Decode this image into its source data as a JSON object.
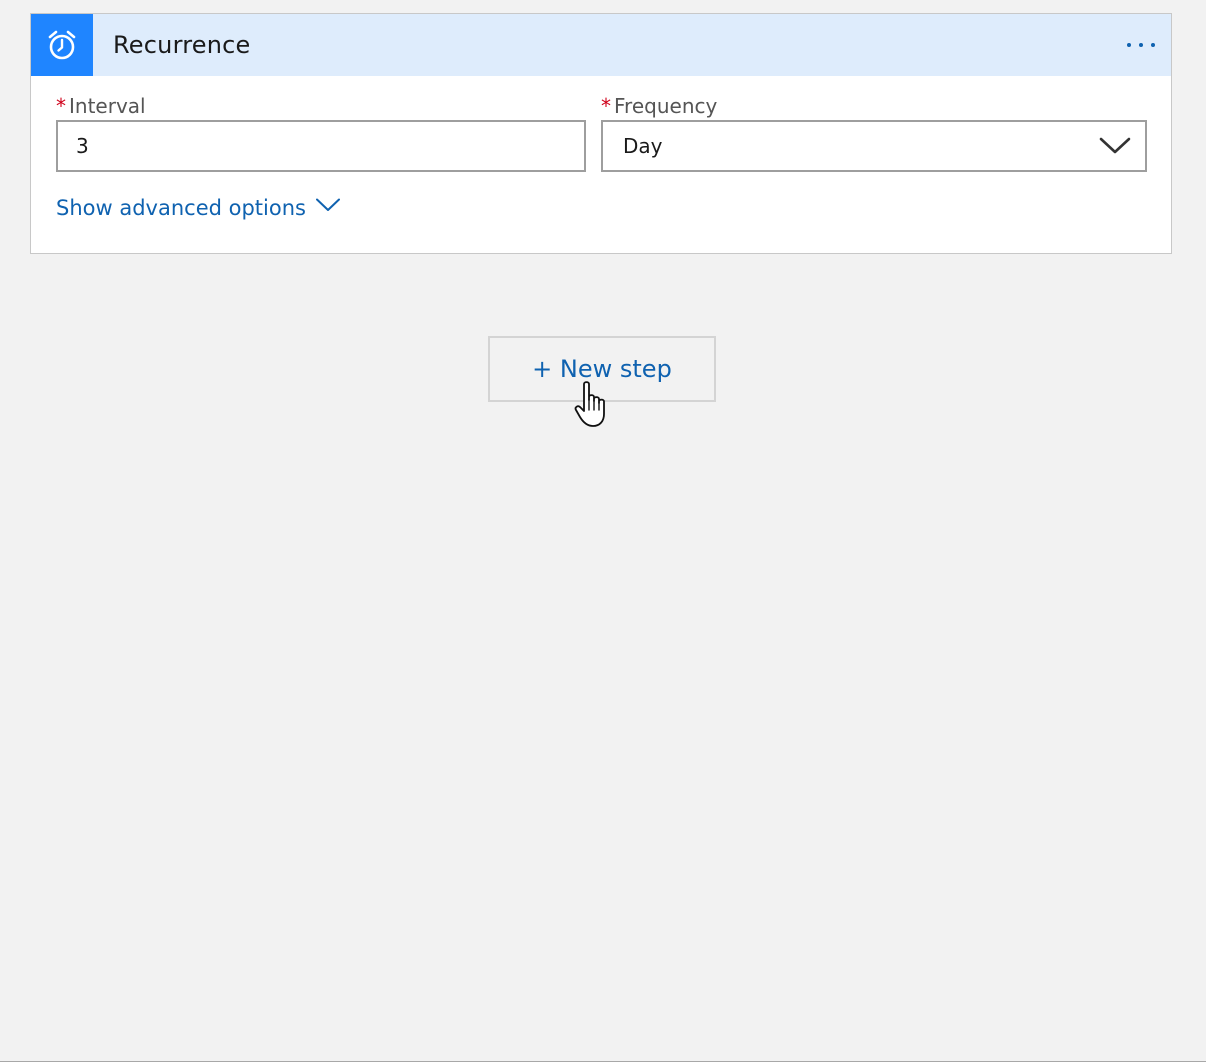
{
  "trigger_card": {
    "title": "Recurrence",
    "icon": "alarm-clock-icon",
    "more_menu_icon": "ellipsis-icon",
    "header_color": "#deecfc",
    "icon_bg_color": "#1f85ff"
  },
  "fields": {
    "interval": {
      "required_mark": "*",
      "label": "Interval",
      "value": "3"
    },
    "frequency": {
      "required_mark": "*",
      "label": "Frequency",
      "value": "Day"
    }
  },
  "advanced_options": {
    "label": "Show advanced options",
    "icon": "chevron-down-icon"
  },
  "new_step": {
    "label": "+ New step"
  },
  "colors": {
    "link": "#0f62b0",
    "required": "#d0021b",
    "canvas_bg": "#f2f2f2"
  }
}
